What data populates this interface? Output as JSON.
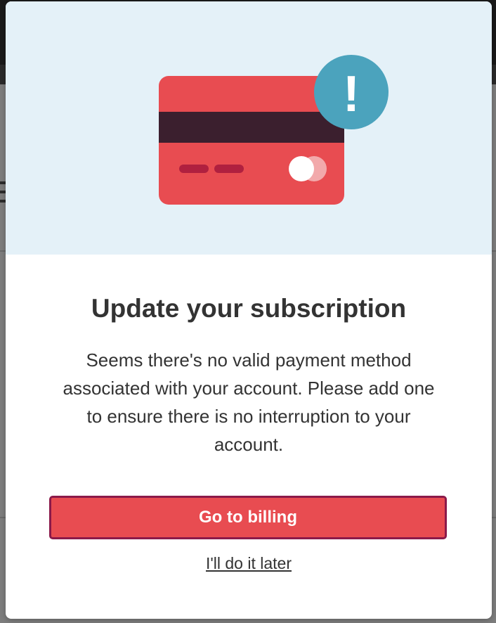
{
  "dialog": {
    "title": "Update your subscription",
    "message": "Seems there's no valid payment method associated with your account. Please add one to ensure there is no interruption to your account.",
    "primary_button_label": "Go to billing",
    "secondary_link_label": "I'll do it later",
    "alert_badge_glyph": "!"
  },
  "illustration": {
    "icon": "credit-card-icon",
    "badge_icon": "exclamation-icon"
  },
  "colors": {
    "hero_background": "#e4f1f8",
    "card": "#e84c51",
    "card_stripe": "#3b1f2e",
    "badge": "#4ba3bd",
    "primary_button": "#e84c51",
    "primary_button_border": "#8b1a4a",
    "text": "#333333"
  }
}
